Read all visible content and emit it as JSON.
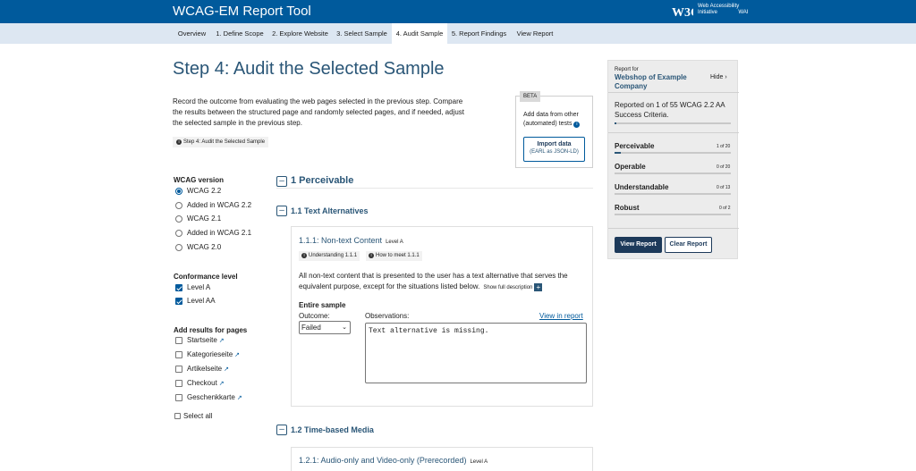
{
  "header": {
    "app_title": "WCAG-EM Report Tool",
    "w3c_logo": "W3C",
    "wai_line1": "Web Accessibility",
    "wai_line2": "Initiative",
    "wai_line3": "WAI"
  },
  "nav": {
    "tabs": [
      {
        "label": "Overview"
      },
      {
        "label": "1. Define Scope"
      },
      {
        "label": "2. Explore Website"
      },
      {
        "label": "3. Select Sample"
      },
      {
        "label": "4. Audit Sample",
        "active": true
      },
      {
        "label": "5. Report Findings"
      },
      {
        "label": "View Report"
      }
    ]
  },
  "main": {
    "title": "Step 4: Audit the Selected Sample",
    "intro": "Record the outcome from evaluating the web pages selected in the previous step. Compare the results between the structured page and randomly selected pages, and if needed, adjust the selected sample in the previous step.",
    "step_badge": "Step 4: Audit the Selected Sample"
  },
  "beta": {
    "tag": "BETA",
    "text": "Add data from other (automated) tests",
    "import_line1": "Import data",
    "import_line2": "(EARL as JSON-LD)"
  },
  "filters": {
    "wcag_heading": "WCAG version",
    "wcag_options": [
      "WCAG 2.2",
      "Added in WCAG 2.2",
      "WCAG 2.1",
      "Added in WCAG 2.1",
      "WCAG 2.0"
    ],
    "wcag_selected": "WCAG 2.2",
    "conformance_heading": "Conformance level",
    "levels": [
      {
        "label": "Level A",
        "checked": true
      },
      {
        "label": "Level AA",
        "checked": true
      }
    ],
    "pages_heading": "Add results for pages",
    "pages": [
      "Startseite",
      "Kategorieseite",
      "Artikelseite",
      "Checkout",
      "Geschenkkarte"
    ],
    "select_all": "Select all"
  },
  "audit": {
    "principle_toggle": "–",
    "principle_title": "1 Perceivable",
    "guideline1_title": "1.1 Text Alternatives",
    "criterion1": {
      "title": "1.1.1: Non-text Content",
      "level": "Level A",
      "chip_understanding": "Understanding 1.1.1",
      "chip_howto": "How to meet 1.1.1",
      "description": "All non-text content that is presented to the user has a text alternative that serves the equivalent purpose, except for the situations listed below.",
      "show_full": "Show full description",
      "plus": "+",
      "sample_heading": "Entire sample",
      "outcome_label": "Outcome:",
      "outcome_value": "Failed",
      "observations_label": "Observations:",
      "view_in_report": "View in report",
      "observation_text": "Text alternative is missing."
    },
    "guideline2_title": "1.2 Time-based Media",
    "criterion2": {
      "title": "1.2.1: Audio-only and Video-only (Prerecorded)",
      "level": "Level A"
    }
  },
  "panel": {
    "report_for": "Report for",
    "site_name": "Webshop of Example Company",
    "hide": "Hide",
    "reported_text": "Reported on 1 of 55 WCAG 2.2 AA Success Criteria.",
    "overall_progress": 0.018,
    "principles": [
      {
        "name": "Perceivable",
        "count": "1 of 20",
        "progress": 0.05
      },
      {
        "name": "Operable",
        "count": "0 of 20",
        "progress": 0
      },
      {
        "name": "Understandable",
        "count": "0 of 13",
        "progress": 0
      },
      {
        "name": "Robust",
        "count": "0 of 2",
        "progress": 0
      }
    ],
    "view_report": "View Report",
    "clear_report": "Clear Report"
  },
  "colors": {
    "brand": "#005a9c",
    "heading": "#2a5677",
    "nav_bg": "#dde7f2",
    "panel_bg": "#ececec"
  },
  "icons": [
    "info-icon",
    "chevron-right-icon",
    "external-link-icon",
    "collapse-icon",
    "caret-down-icon",
    "plus-icon"
  ]
}
